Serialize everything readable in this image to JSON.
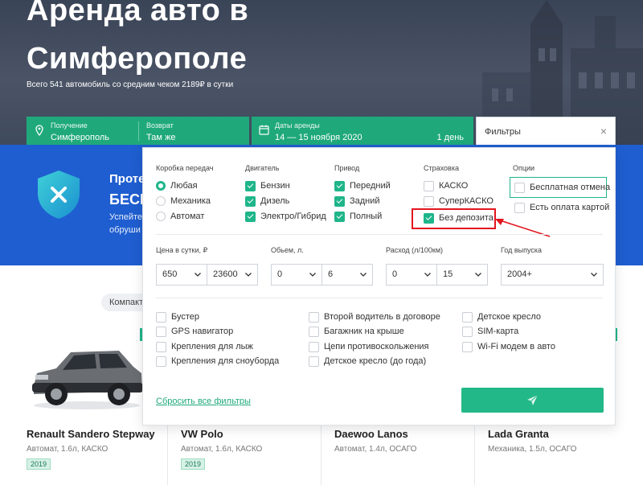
{
  "hero": {
    "title_line1": "Аренда авто в",
    "title_line2": "Симферополе",
    "subtitle": "Всего 541 автомобиль со средним чеком 2189₽ в сутки"
  },
  "search": {
    "pickup_caption": "Получение",
    "pickup_value": "Симферополь",
    "return_caption": "Возврат",
    "return_value": "Там же",
    "dates_caption": "Даты аренды",
    "dates_value": "14 — 15 ноября 2020",
    "days_value": "1 день",
    "filters_label": "Фильтры",
    "close_glyph": "×"
  },
  "banner": {
    "line1": "Проте",
    "line2": "БЕСП",
    "line3": "Успейте",
    "line4": "обруши"
  },
  "filters": {
    "gearbox": {
      "title": "Коробка передач",
      "options": [
        {
          "label": "Любая",
          "selected": true
        },
        {
          "label": "Механика",
          "selected": false
        },
        {
          "label": "Автомат",
          "selected": false
        }
      ]
    },
    "engine": {
      "title": "Двигатель",
      "options": [
        {
          "label": "Бензин",
          "checked": true
        },
        {
          "label": "Дизель",
          "checked": true
        },
        {
          "label": "Электро/Гибрид",
          "checked": true
        }
      ]
    },
    "drive": {
      "title": "Привод",
      "options": [
        {
          "label": "Передний",
          "checked": true
        },
        {
          "label": "Задний",
          "checked": true
        },
        {
          "label": "Полный",
          "checked": true
        }
      ]
    },
    "insurance": {
      "title": "Страховка",
      "options": [
        {
          "label": "КАСКО",
          "checked": false
        },
        {
          "label": "СуперКАСКО",
          "checked": false
        },
        {
          "label": "Без депозита",
          "checked": true
        }
      ]
    },
    "options": {
      "title": "Опции",
      "options": [
        {
          "label": "Бесплатная отмена",
          "checked": false
        },
        {
          "label": "Есть оплата картой",
          "checked": false
        }
      ]
    },
    "price": {
      "title": "Цена в сутки, ₽",
      "from": "650",
      "to": "23600"
    },
    "volume": {
      "title": "Обьем, л.",
      "from": "0",
      "to": "6"
    },
    "consumption": {
      "title": "Расход (л/100км)",
      "from": "0",
      "to": "15"
    },
    "year": {
      "title": "Год выпуска",
      "value": "2004+"
    },
    "extras": [
      [
        "Бустер",
        "GPS навигатор",
        "Крепления для лыж",
        "Крепления для сноуборда"
      ],
      [
        "Второй водитель в договоре",
        "Багажник на крыше",
        "Цепи противоскольжения",
        "Детское кресло (до года)"
      ],
      [
        "Детское кресло",
        "SIM-карта",
        "Wi-Fi модем в авто"
      ]
    ],
    "reset_label": "Сбросить все фильтры"
  },
  "listing": {
    "category_pill": "Компакт",
    "cars": [
      {
        "name": "Renault Sandero Stepway",
        "spec": "Автомат, 1.6л, КАСКО",
        "year": "2019"
      },
      {
        "name": "VW Polo",
        "spec": "Автомат, 1.6л, КАСКО",
        "year": "2019"
      },
      {
        "name": "Daewoo Lanos",
        "spec": "Автомат, 1.4л, ОСАГО",
        "year": ""
      },
      {
        "name": "Lada Granta",
        "spec": "Механика, 1.5л, ОСАГО",
        "year": ""
      }
    ]
  },
  "colors": {
    "accent": "#1fb58a",
    "brand_blue": "#1f5ed0",
    "highlight_red": "#e2161f"
  }
}
